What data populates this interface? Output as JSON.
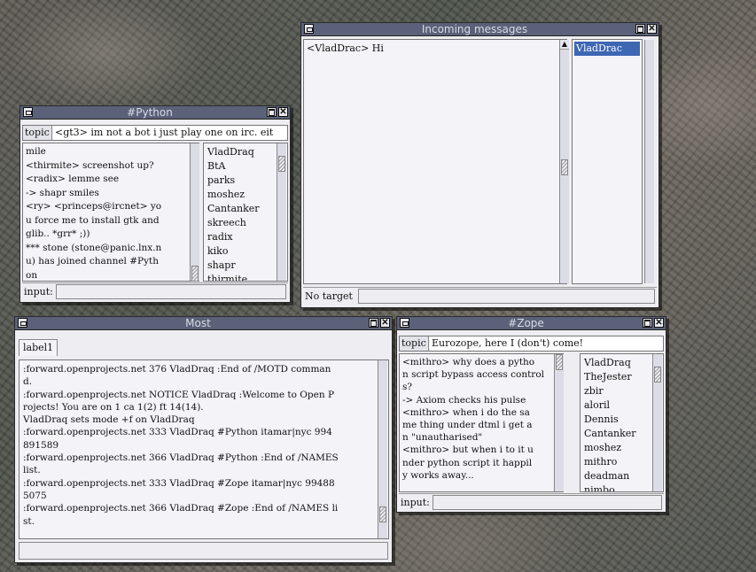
{
  "incoming": {
    "title": "Incoming messages",
    "messages": [
      "<VladDrac>  Hi"
    ],
    "targets": [
      "VladDrac"
    ],
    "status_label": "No target"
  },
  "python": {
    "title": "#Python",
    "topic_label": "topic",
    "topic": "<gt3>  im not a bot i just play one on irc. eit",
    "messages": [
      "mile",
      "<thirmite>  screenshot up?",
      "<radix>  lemme see",
      "-> shapr smiles",
      "<ry>  <princeps@ircnet>  yo",
      "u force me to install gtk and",
      "glib.. *grr* ;))",
      "*** stone (stone@panic.lnx.n",
      "u) has joined channel #Pyth",
      "on"
    ],
    "nicks": [
      "VladDraq",
      "BtA",
      "parks",
      "moshez",
      "Cantanker",
      "skreech",
      "radix",
      "kiko",
      "shapr",
      "thirmite"
    ],
    "input_label": "input:"
  },
  "most": {
    "title": "Most",
    "tab_label": "label1",
    "messages": [
      ":forward.openprojects.net 376 VladDraq :End of /MOTD comman",
      "d.",
      ":forward.openprojects.net  NOTICE VladDraq :Welcome to Open P",
      "rojects!  You are on 1 ca 1(2) ft 14(14).",
      "VladDraq sets mode +f on VladDraq",
      ":forward.openprojects.net 333 VladDraq #Python itamar|nyc 994",
      "891589",
      ":forward.openprojects.net 366 VladDraq #Python :End of /NAMES",
      " list.",
      ":forward.openprojects.net 333 VladDraq #Zope itamar|nyc 99488",
      "5075",
      ":forward.openprojects.net 366 VladDraq #Zope :End of /NAMES li",
      "st."
    ]
  },
  "zope": {
    "title": "#Zope",
    "topic_label": "topic",
    "topic": "Eurozope, here I (don't) come!",
    "messages": [
      "<mithro>  why does a pytho",
      "n script bypass access control",
      "s?",
      "-> Axiom checks his pulse",
      "<mithro>  when i do the sa",
      "me thing under dtml i get a",
      "n \"unautharised\"",
      "<mithro>  but when i to it u",
      "nder python script it happil",
      "y works away..."
    ],
    "nicks": [
      "VladDraq",
      "TheJester",
      "zbir",
      "aloril",
      "Dennis",
      "Cantanker",
      "moshez",
      "mithro",
      "deadman",
      "nimbo"
    ],
    "input_label": "input:"
  }
}
